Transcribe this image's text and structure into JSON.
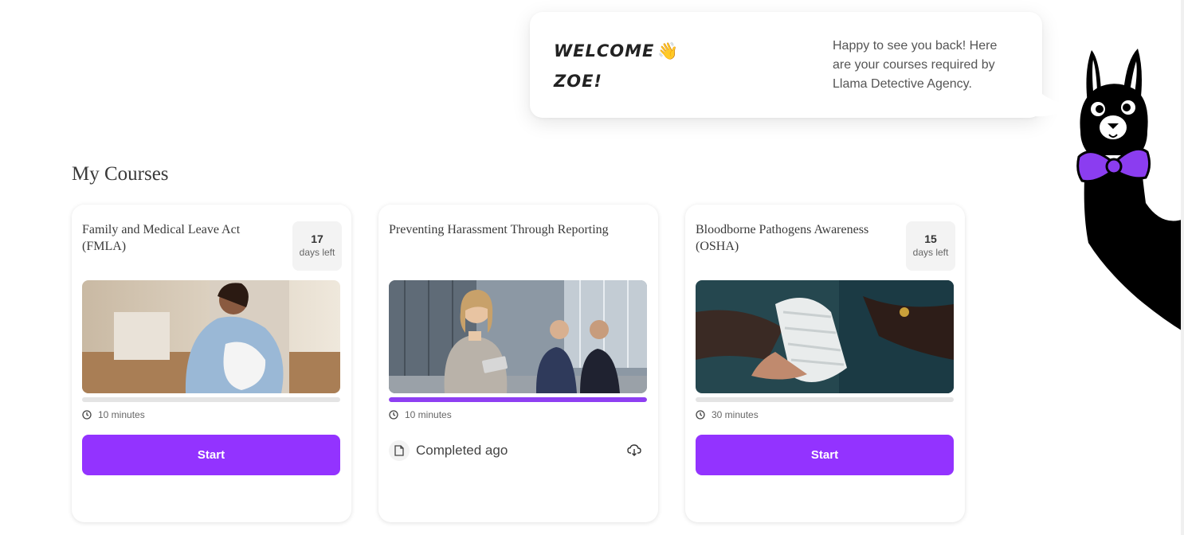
{
  "welcome": {
    "title": "WELCOME",
    "name": "ZOE!",
    "wave_icon": "waving-hand-icon",
    "message": "Happy to see you back! Here are your courses required by Llama Detective Agency."
  },
  "section_title": "My Courses",
  "colors": {
    "accent": "#9333ff",
    "progress": "#8e3ff2",
    "llama_bow": "#8b3df0"
  },
  "courses": [
    {
      "title": "Family and Medical Leave Act (FMLA)",
      "days_num": "17",
      "days_label": "days left",
      "progress_percent": 0,
      "duration": "10 minutes",
      "action_label": "Start"
    },
    {
      "title": "Preventing Harassment Through Reporting",
      "progress_percent": 100,
      "duration": "10 minutes",
      "completed_text": "Completed ago"
    },
    {
      "title": "Bloodborne Pathogens Awareness (OSHA)",
      "days_num": "15",
      "days_label": "days left",
      "progress_percent": 0,
      "duration": "30 minutes",
      "action_label": "Start"
    }
  ]
}
